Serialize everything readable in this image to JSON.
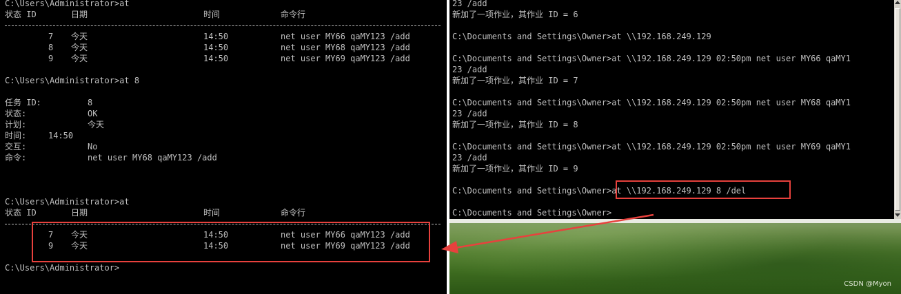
{
  "left_terminal": {
    "prompt1": "C:\\Users\\Administrator>at",
    "table1": {
      "headers": [
        "状态 ID",
        "日期",
        "时间",
        "命令行"
      ],
      "rows": [
        {
          "id": "7",
          "date": "今天",
          "time": "14:50",
          "command": "net user MY66 qaMY123 /add"
        },
        {
          "id": "8",
          "date": "今天",
          "time": "14:50",
          "command": "net user MY68 qaMY123 /add"
        },
        {
          "id": "9",
          "date": "今天",
          "time": "14:50",
          "command": "net user MY69 qaMY123 /add"
        }
      ]
    },
    "prompt2": "C:\\Users\\Administrator>at 8",
    "details": [
      {
        "label": "任务 ID:",
        "value": "8"
      },
      {
        "label": "状态:",
        "value": "OK"
      },
      {
        "label": "计划:",
        "value": "今天"
      },
      {
        "label": "时间:",
        "value": "14:50"
      },
      {
        "label": "交互:",
        "value": "No"
      },
      {
        "label": "命令:",
        "value": "net user MY68 qaMY123 /add"
      }
    ],
    "prompt3": "C:\\Users\\Administrator>at",
    "table2": {
      "headers": [
        "状态 ID",
        "日期",
        "时间",
        "命令行"
      ],
      "rows": [
        {
          "id": "7",
          "date": "今天",
          "time": "14:50",
          "command": "net user MY66 qaMY123 /add"
        },
        {
          "id": "9",
          "date": "今天",
          "time": "14:50",
          "command": "net user MY69 qaMY123 /add"
        }
      ]
    },
    "prompt4": "C:\\Users\\Administrator>"
  },
  "right_terminal": {
    "lines": [
      "23 /add",
      "新加了一项作业，其作业 ID = 6",
      "",
      "C:\\Documents and Settings\\Owner>at \\\\192.168.249.129",
      "",
      "C:\\Documents and Settings\\Owner>at \\\\192.168.249.129 02:50pm net user MY66 qaMY1",
      "23 /add",
      "新加了一项作业，其作业 ID = 7",
      "",
      "C:\\Documents and Settings\\Owner>at \\\\192.168.249.129 02:50pm net user MY68 qaMY1",
      "23 /add",
      "新加了一项作业，其作业 ID = 8",
      "",
      "C:\\Documents and Settings\\Owner>at \\\\192.168.249.129 02:50pm net user MY69 qaMY1",
      "23 /add",
      "新加了一项作业，其作业 ID = 9",
      "",
      "C:\\Documents and Settings\\Owner>at \\\\192.168.249.129 8 /del",
      "",
      "C:\\Documents and Settings\\Owner>"
    ]
  },
  "watermark": "CSDN @Myon⁠",
  "colors": {
    "terminal_bg": "#000000",
    "terminal_text": "#c0c0c0",
    "highlight": "#e8413d"
  }
}
